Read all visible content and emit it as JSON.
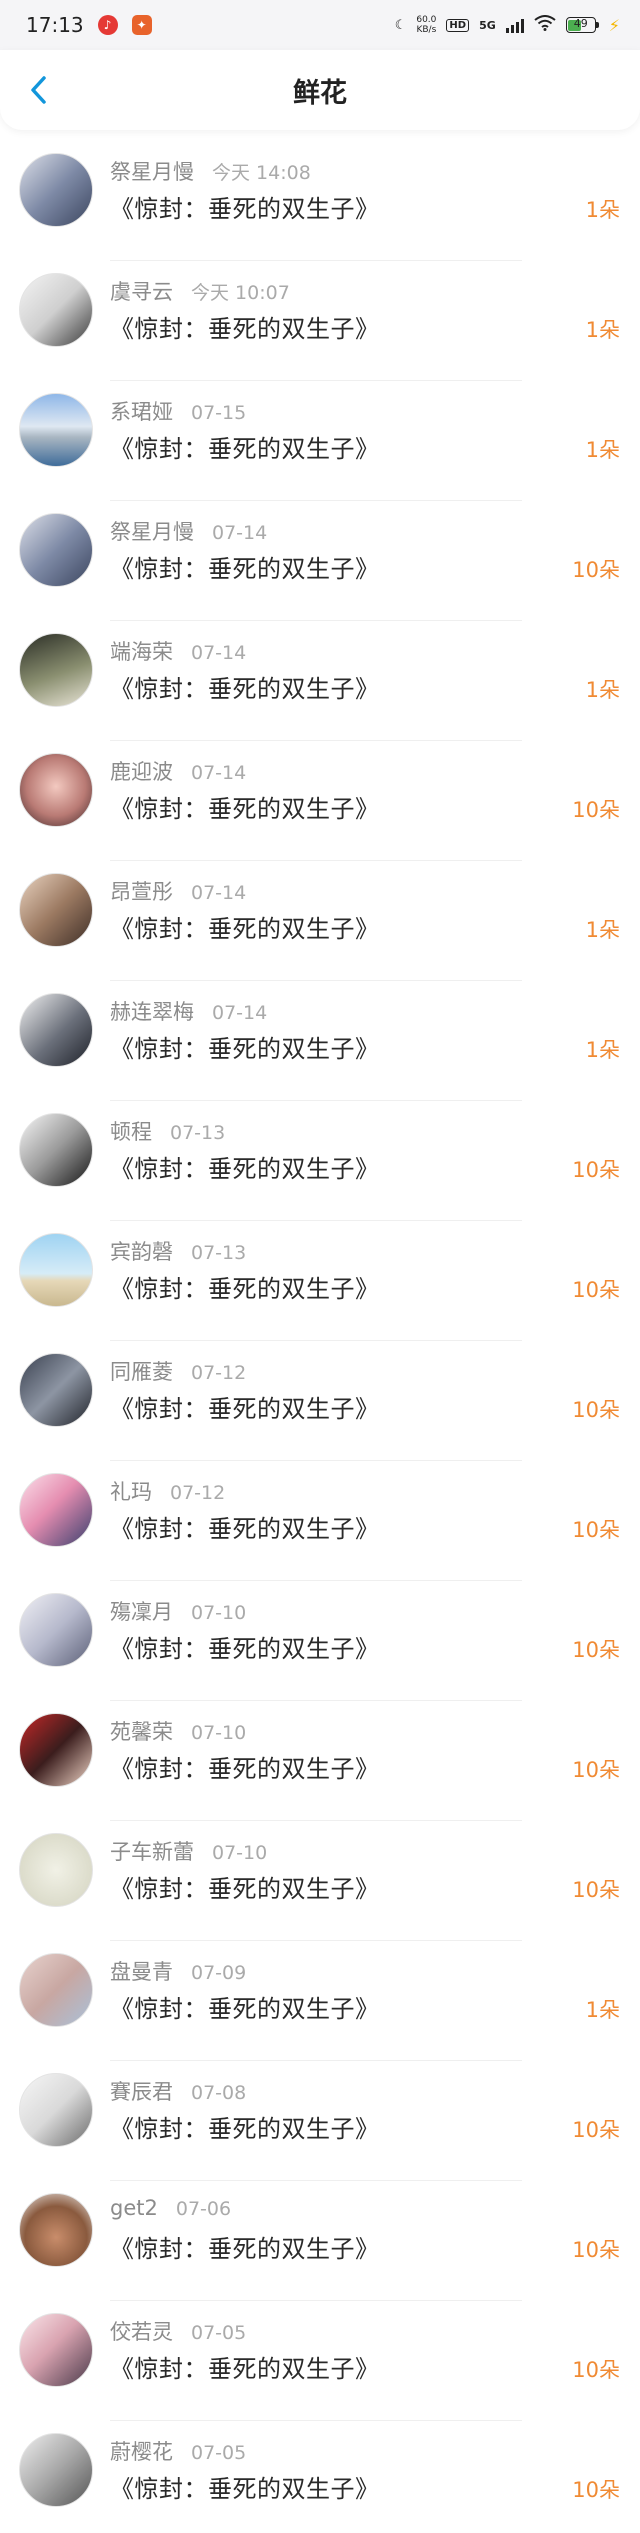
{
  "status_bar": {
    "time": "17:13",
    "net_speed_value": "60.0",
    "net_speed_unit": "KB/s",
    "hd": "HD",
    "network": "5G",
    "battery": "49"
  },
  "header": {
    "title": "鲜花"
  },
  "colors": {
    "accent": "#1296db",
    "count": "#f08a33"
  },
  "items": [
    {
      "name": "祭星月慢",
      "date": "今天 14:08",
      "title": "《惊封：垂死的双生子》",
      "count": "1朵",
      "avatar": "linear-gradient(135deg,#dcdfe8,#7e8aa6 50%,#3c4660)"
    },
    {
      "name": "虞寻云",
      "date": "今天 10:07",
      "title": "《惊封：垂死的双生子》",
      "count": "1朵",
      "avatar": "linear-gradient(135deg,#f4f4f4,#cfcfcf 50%,#3a3a3a)"
    },
    {
      "name": "系珺娅",
      "date": "07-15",
      "title": "《惊封：垂死的双生子》",
      "count": "1朵",
      "avatar": "linear-gradient(180deg,#8fb7e8,#dfe8f2 45%,#a9b6c2 60%,#3f6c9a)"
    },
    {
      "name": "祭星月慢",
      "date": "07-14",
      "title": "《惊封：垂死的双生子》",
      "count": "10朵",
      "avatar": "linear-gradient(135deg,#dcdfe8,#7e8aa6 50%,#3c4660)"
    },
    {
      "name": "端海荣",
      "date": "07-14",
      "title": "《惊封：垂死的双生子》",
      "count": "1朵",
      "avatar": "linear-gradient(160deg,#2b2e26,#8a8f70 55%,#e8e4d6)"
    },
    {
      "name": "鹿迎波",
      "date": "07-14",
      "title": "《惊封：垂死的双生子》",
      "count": "10朵",
      "avatar": "radial-gradient(circle at 50% 45%,#f3c9c0,#b97a74 55%,#3b2527)"
    },
    {
      "name": "昂萱彤",
      "date": "07-14",
      "title": "《惊封：垂死的双生子》",
      "count": "1朵",
      "avatar": "linear-gradient(135deg,#e9d3c0,#9c7a62 50%,#3e2e27)"
    },
    {
      "name": "赫连翠梅",
      "date": "07-14",
      "title": "《惊封：垂死的双生子》",
      "count": "1朵",
      "avatar": "linear-gradient(135deg,#f1f1f1,#6a6f7a 55%,#1e2129)"
    },
    {
      "name": "顿程",
      "date": "07-13",
      "title": "《惊封：垂死的双生子》",
      "count": "10朵",
      "avatar": "linear-gradient(135deg,#f7f7f7,#9a9a9a 50%,#161616)"
    },
    {
      "name": "宾韵磬",
      "date": "07-13",
      "title": "《惊封：垂死的双生子》",
      "count": "10朵",
      "avatar": "linear-gradient(180deg,#9fd3f2,#d6ecf7 55%,#e6d8b8 65%,#c9b88f)"
    },
    {
      "name": "同雁菱",
      "date": "07-12",
      "title": "《惊封：垂死的双生子》",
      "count": "10朵",
      "avatar": "linear-gradient(135deg,#3a4150,#8d95a3 50%,#20232a)"
    },
    {
      "name": "礼玛",
      "date": "07-12",
      "title": "《惊封：垂死的双生子》",
      "count": "10朵",
      "avatar": "linear-gradient(135deg,#fbe0ea,#e58db0 45%,#3a3f6e)"
    },
    {
      "name": "殤凜月",
      "date": "07-10",
      "title": "《惊封：垂死的双生子》",
      "count": "10朵",
      "avatar": "linear-gradient(135deg,#f0f0f5,#b6b9cc 50%,#5c6078)"
    },
    {
      "name": "苑馨荣",
      "date": "07-10",
      "title": "《惊封：垂死的双生子》",
      "count": "10朵",
      "avatar": "linear-gradient(135deg,#c62828,#3b1d1d 50%,#f0d5c6)"
    },
    {
      "name": "子车新蕾",
      "date": "07-10",
      "title": "《惊封：垂死的双生子》",
      "count": "10朵",
      "avatar": "radial-gradient(circle at 50% 50%,#f1f1e6,#dcdccb 70%,#c9c9b4)"
    },
    {
      "name": "盘曼青",
      "date": "07-09",
      "title": "《惊封：垂死的双生子》",
      "count": "1朵",
      "avatar": "linear-gradient(135deg,#e8d3ce,#c8a7a2 50%,#a9c1d9)"
    },
    {
      "name": "賽辰君",
      "date": "07-08",
      "title": "《惊封：垂死的双生子》",
      "count": "10朵",
      "avatar": "linear-gradient(135deg,#f7f7f7,#d9d9d9 50%,#6b6b6b)"
    },
    {
      "name": "get2",
      "date": "07-06",
      "title": "《惊封：垂死的双生子》",
      "count": "10朵",
      "avatar": "radial-gradient(circle at 50% 60%,#c98d6b,#8a5a3e 55%,#f3f3f3)"
    },
    {
      "name": "佼若灵",
      "date": "07-05",
      "title": "《惊封：垂死的双生子》",
      "count": "10朵",
      "avatar": "linear-gradient(135deg,#fbe6ea,#d9a3b0 45%,#4a3a4a)"
    },
    {
      "name": "蔚樱花",
      "date": "07-05",
      "title": "《惊封：垂死的双生子》",
      "count": "10朵",
      "avatar": "linear-gradient(135deg,#eeeeee,#a8a8a8 50%,#555555)"
    }
  ]
}
